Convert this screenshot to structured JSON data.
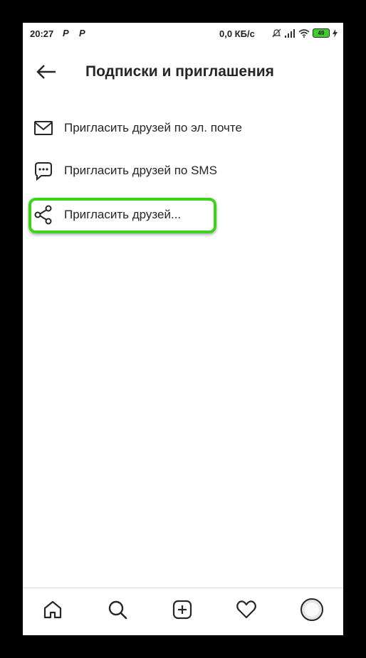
{
  "status_bar": {
    "time": "20:27",
    "notif1": "P",
    "notif2": "P",
    "network_speed": "0,0 КБ/с",
    "battery": "49"
  },
  "header": {
    "title": "Подписки и приглашения"
  },
  "menu": {
    "items": [
      {
        "label": "Пригласить друзей по эл. почте",
        "icon": "mail-icon"
      },
      {
        "label": "Пригласить друзей по SMS",
        "icon": "sms-icon"
      },
      {
        "label": "Пригласить друзей...",
        "icon": "share-icon"
      }
    ],
    "highlight_color": "#3fd21d"
  },
  "bottom_nav": {
    "items": [
      "home-icon",
      "search-icon",
      "add-icon",
      "heart-icon",
      "profile-avatar"
    ]
  }
}
